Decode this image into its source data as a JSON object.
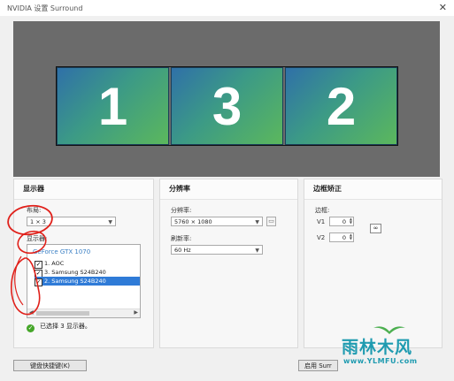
{
  "window": {
    "title": "NVIDIA 设置 Surround",
    "close_glyph": "✕"
  },
  "preview": {
    "screens": [
      "1",
      "3",
      "2"
    ]
  },
  "displays_panel": {
    "header": "显示器",
    "layout_label": "布局:",
    "layout_value": "1 × 3",
    "displays_label": "显示器:",
    "group": "GeForce GTX 1070",
    "items": [
      {
        "label": "1. AOC",
        "checked": true,
        "selected": false
      },
      {
        "label": "3. Samsung S24B240",
        "checked": true,
        "selected": false
      },
      {
        "label": "2. Samsung S24B240",
        "checked": true,
        "selected": true
      }
    ],
    "status": "已选择 3 显示器。"
  },
  "resolution_panel": {
    "header": "分辨率",
    "resolution_label": "分辨率:",
    "resolution_value": "5760 × 1080",
    "refresh_label": "刷新率:",
    "refresh_value": "60 Hz"
  },
  "bezel_panel": {
    "header": "边框矫正",
    "bezel_label": "边框:",
    "v1_label": "V1",
    "v1_value": "0",
    "v2_label": "V2",
    "v2_value": "0"
  },
  "footer": {
    "hotkeys_button": "键盘快捷键(K)",
    "enable_button": "启用 Surr"
  },
  "watermark": {
    "text": "雨林木风",
    "url": "www.YLMFU.com"
  },
  "colors": {
    "selection": "#2f7bd7",
    "group_text": "#3a7fc4",
    "status_ok": "#45a629",
    "annotation": "#e0201a"
  }
}
